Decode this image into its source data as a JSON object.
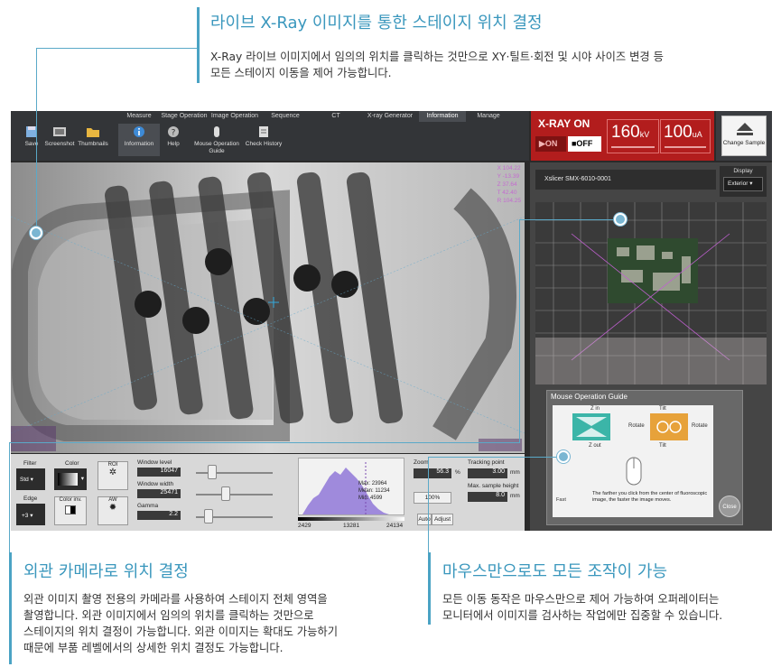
{
  "callouts": {
    "top": {
      "title": "라이브 X-Ray 이미지를 통한 스테이지 위치 결정",
      "lines": [
        "X-Ray 라이브 이미지에서 임의의 위치를 클릭하는 것만으로 XY·틸트·회전 및 시야 사이즈 변경 등",
        "모든 스테이지 이동을 제어 가능합니다."
      ]
    },
    "bottom_left": {
      "title": "외관 카메라로 위치 결정",
      "lines": [
        "외관 이미지 촬영 전용의 카메라를 사용하여 스테이지 전체 영역을",
        "촬영합니다. 외관 이미지에서 임의의 위치를 클릭하는 것만으로",
        "스테이지의 위치 결정이 가능합니다. 외관 이미지는 확대도 가능하기",
        "때문에 부품 레벨에서의 상세한 위치 결정도 가능합니다."
      ]
    },
    "bottom_right": {
      "title": "마우스만으로도 모든 조작이 가능",
      "lines": [
        "모든 이동 동작은 마우스만으로 제어 가능하여 오퍼레이터는",
        "모니터에서 이미지를 검사하는 작업에만 집중할 수 있습니다."
      ]
    }
  },
  "app": {
    "tabs": [
      "Measure",
      "Stage Operation",
      "Image Operation",
      "Sequence",
      "CT",
      "X-ray Generator",
      "Information",
      "Manage"
    ],
    "active_tab": "Information",
    "tools": [
      {
        "label": "Save",
        "icon": "save-icon"
      },
      {
        "label": "Screenshot",
        "icon": "screenshot-icon"
      },
      {
        "label": "Thumbnails",
        "icon": "folder-icon"
      },
      {
        "label": "Information",
        "icon": "info-icon"
      },
      {
        "label": "Help",
        "icon": "help-icon"
      },
      {
        "label": "Mouse Operation Guide",
        "icon": "mouse-icon"
      },
      {
        "label": "Check History",
        "icon": "history-icon"
      }
    ],
    "xray": {
      "title": "X-RAY ON",
      "on_label": "▶ON",
      "off_label": "■OFF",
      "kv_value": "160",
      "kv_unit": "kV",
      "ua_value": "100",
      "ua_unit": "uA",
      "panel_color": "#b21d1d"
    },
    "change_sample": "Change Sample",
    "viewer": {
      "coords": [
        "X  104.22",
        "Y  -13.39",
        "Z  37.64",
        "T  42.40",
        "R  104.25"
      ]
    },
    "controls": {
      "filter_label": "Filter",
      "filter_value": "Std",
      "color_label": "Color",
      "roi_label": "ROI",
      "edge_label": "Edge",
      "edge_value": "+3",
      "color_inv_label": "Color inv.",
      "aw_label": "AW",
      "window_level_label": "Window level",
      "window_level_value": "16047",
      "window_width_label": "Window width",
      "window_width_value": "25471",
      "gamma_label": "Gamma",
      "gamma_value": "2.2",
      "histogram_max_label": "Max:",
      "histogram_max_value": "23964",
      "histogram_mean_label": "Mean:",
      "histogram_mean_value": "11234",
      "histogram_min_label": "Min:",
      "histogram_min_value": "4599",
      "histogram_ticks": [
        "2429",
        "13281",
        "24134"
      ],
      "zoom_label": "Zoom",
      "zoom_value": "56.3",
      "zoom_unit": "%",
      "zoom_100": "100%",
      "tracking_label": "Tracking point",
      "tracking_value": "3.00",
      "tracking_unit": "mm",
      "max_sample_label": "Max. sample height",
      "max_sample_value": "8.0",
      "max_sample_unit": "mm",
      "auto_label": "Auto",
      "adjust_label": "Adjust"
    },
    "camera": {
      "header": "Xslicer SMX-6010-0001",
      "display_label": "Display",
      "display_value": "Exterior"
    },
    "guide": {
      "title": "Mouse Operation Guide",
      "zoom_in": "Z in",
      "zoom_out": "Z out",
      "tilt": "Tilt",
      "rotate": "Rotate",
      "note": "The farther you click from the center of fluoroscopic image, the faster the image moves.",
      "fast": "Fast",
      "close": "Close"
    }
  }
}
